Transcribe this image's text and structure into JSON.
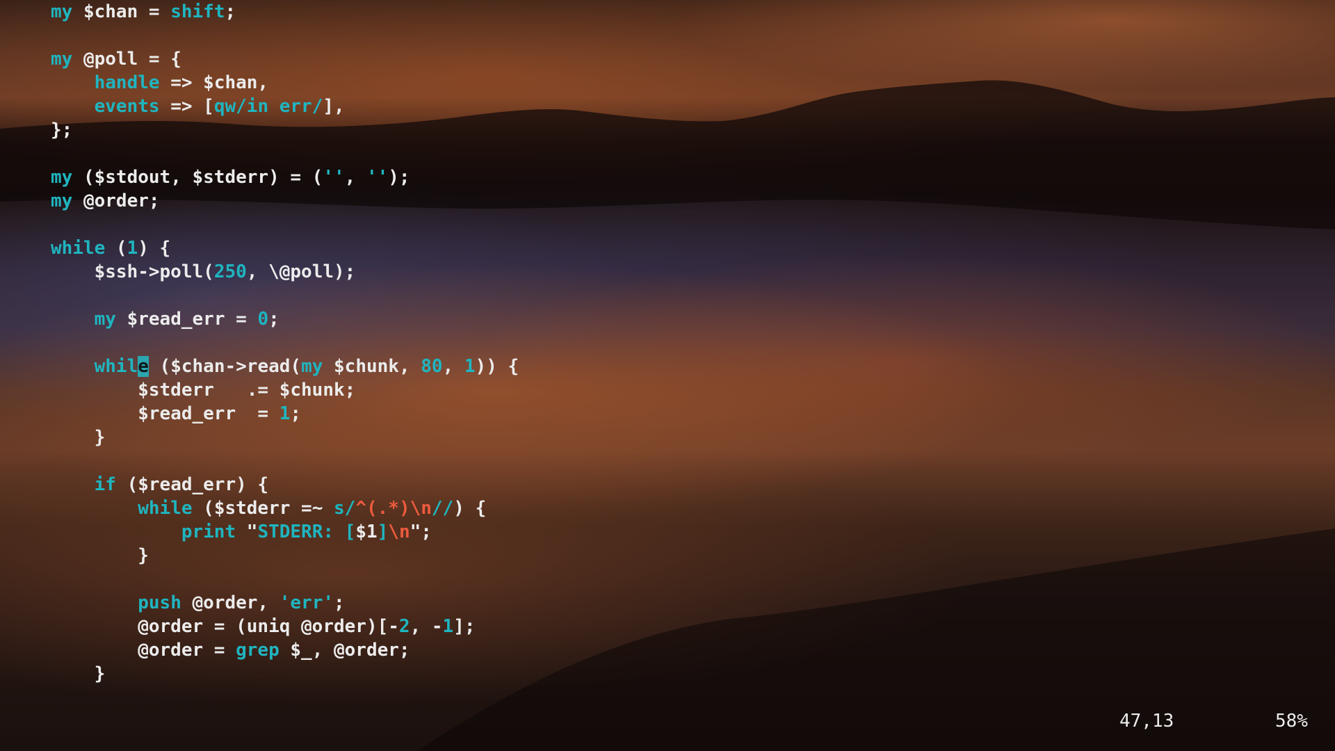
{
  "window": {
    "type": "terminal-vim"
  },
  "colors": {
    "keyword": "#1fb5c0",
    "regex": "#ec5b3e",
    "text": "#ececec",
    "cursor": "#2aa6b0"
  },
  "code": {
    "lines": [
      {
        "tokens": [
          {
            "t": "my",
            "c": "kw"
          },
          {
            "t": " $chan = ",
            "c": "plain"
          },
          {
            "t": "shift",
            "c": "kw"
          },
          {
            "t": ";",
            "c": "plain"
          }
        ]
      },
      {
        "tokens": []
      },
      {
        "tokens": [
          {
            "t": "my",
            "c": "kw"
          },
          {
            "t": " @poll = {",
            "c": "plain"
          }
        ]
      },
      {
        "tokens": [
          {
            "t": "    ",
            "c": "plain"
          },
          {
            "t": "handle",
            "c": "kw"
          },
          {
            "t": " => $chan,",
            "c": "plain"
          }
        ]
      },
      {
        "tokens": [
          {
            "t": "    ",
            "c": "plain"
          },
          {
            "t": "events",
            "c": "kw"
          },
          {
            "t": " => [",
            "c": "plain"
          },
          {
            "t": "qw/in err/",
            "c": "str"
          },
          {
            "t": "],",
            "c": "plain"
          }
        ]
      },
      {
        "tokens": [
          {
            "t": "};",
            "c": "plain"
          }
        ]
      },
      {
        "tokens": []
      },
      {
        "tokens": [
          {
            "t": "my",
            "c": "kw"
          },
          {
            "t": " ($stdout, $stderr) = (",
            "c": "plain"
          },
          {
            "t": "''",
            "c": "str"
          },
          {
            "t": ", ",
            "c": "plain"
          },
          {
            "t": "''",
            "c": "str"
          },
          {
            "t": ");",
            "c": "plain"
          }
        ]
      },
      {
        "tokens": [
          {
            "t": "my",
            "c": "kw"
          },
          {
            "t": " @order;",
            "c": "plain"
          }
        ]
      },
      {
        "tokens": []
      },
      {
        "tokens": [
          {
            "t": "while",
            "c": "kw"
          },
          {
            "t": " (",
            "c": "plain"
          },
          {
            "t": "1",
            "c": "num"
          },
          {
            "t": ") {",
            "c": "plain"
          }
        ]
      },
      {
        "tokens": [
          {
            "t": "    $ssh->poll(",
            "c": "plain"
          },
          {
            "t": "250",
            "c": "num"
          },
          {
            "t": ", \\@poll);",
            "c": "plain"
          }
        ]
      },
      {
        "tokens": []
      },
      {
        "tokens": [
          {
            "t": "    ",
            "c": "plain"
          },
          {
            "t": "my",
            "c": "kw"
          },
          {
            "t": " $read_err = ",
            "c": "plain"
          },
          {
            "t": "0",
            "c": "num"
          },
          {
            "t": ";",
            "c": "plain"
          }
        ]
      },
      {
        "tokens": []
      },
      {
        "tokens": [
          {
            "t": "    ",
            "c": "plain"
          },
          {
            "t": "whil",
            "c": "kw"
          },
          {
            "t": "e",
            "c": "cursor"
          },
          {
            "t": " ($chan->read(",
            "c": "plain"
          },
          {
            "t": "my",
            "c": "kw"
          },
          {
            "t": " $chunk, ",
            "c": "plain"
          },
          {
            "t": "80",
            "c": "num"
          },
          {
            "t": ", ",
            "c": "plain"
          },
          {
            "t": "1",
            "c": "num"
          },
          {
            "t": ")) {",
            "c": "plain"
          }
        ]
      },
      {
        "tokens": [
          {
            "t": "        $stderr   .= $chunk;",
            "c": "plain"
          }
        ]
      },
      {
        "tokens": [
          {
            "t": "        $read_err  = ",
            "c": "plain"
          },
          {
            "t": "1",
            "c": "num"
          },
          {
            "t": ";",
            "c": "plain"
          }
        ]
      },
      {
        "tokens": [
          {
            "t": "    }",
            "c": "plain"
          }
        ]
      },
      {
        "tokens": []
      },
      {
        "tokens": [
          {
            "t": "    ",
            "c": "plain"
          },
          {
            "t": "if",
            "c": "kw"
          },
          {
            "t": " ($read_err) {",
            "c": "plain"
          }
        ]
      },
      {
        "tokens": [
          {
            "t": "        ",
            "c": "plain"
          },
          {
            "t": "while",
            "c": "kw"
          },
          {
            "t": " ($stderr =~ ",
            "c": "plain"
          },
          {
            "t": "s/",
            "c": "str"
          },
          {
            "t": "^(.*)\\n",
            "c": "rx"
          },
          {
            "t": "//",
            "c": "str"
          },
          {
            "t": ") {",
            "c": "plain"
          }
        ]
      },
      {
        "tokens": [
          {
            "t": "            ",
            "c": "plain"
          },
          {
            "t": "print",
            "c": "kw"
          },
          {
            "t": " \"",
            "c": "plain"
          },
          {
            "t": "STDERR: [",
            "c": "str"
          },
          {
            "t": "$1",
            "c": "plain"
          },
          {
            "t": "]",
            "c": "str"
          },
          {
            "t": "\\n",
            "c": "rx"
          },
          {
            "t": "\";",
            "c": "plain"
          }
        ]
      },
      {
        "tokens": [
          {
            "t": "        }",
            "c": "plain"
          }
        ]
      },
      {
        "tokens": []
      },
      {
        "tokens": [
          {
            "t": "        ",
            "c": "plain"
          },
          {
            "t": "push",
            "c": "kw"
          },
          {
            "t": " @order, ",
            "c": "plain"
          },
          {
            "t": "'err'",
            "c": "str"
          },
          {
            "t": ";",
            "c": "plain"
          }
        ]
      },
      {
        "tokens": [
          {
            "t": "        @order = (uniq @order)[-",
            "c": "plain"
          },
          {
            "t": "2",
            "c": "num"
          },
          {
            "t": ", -",
            "c": "plain"
          },
          {
            "t": "1",
            "c": "num"
          },
          {
            "t": "];",
            "c": "plain"
          }
        ]
      },
      {
        "tokens": [
          {
            "t": "        @order = ",
            "c": "plain"
          },
          {
            "t": "grep",
            "c": "kw"
          },
          {
            "t": " $_, @order;",
            "c": "plain"
          }
        ]
      },
      {
        "tokens": [
          {
            "t": "    }",
            "c": "plain"
          }
        ]
      }
    ]
  },
  "statusline": {
    "position": "47,13",
    "percent": "58%"
  }
}
